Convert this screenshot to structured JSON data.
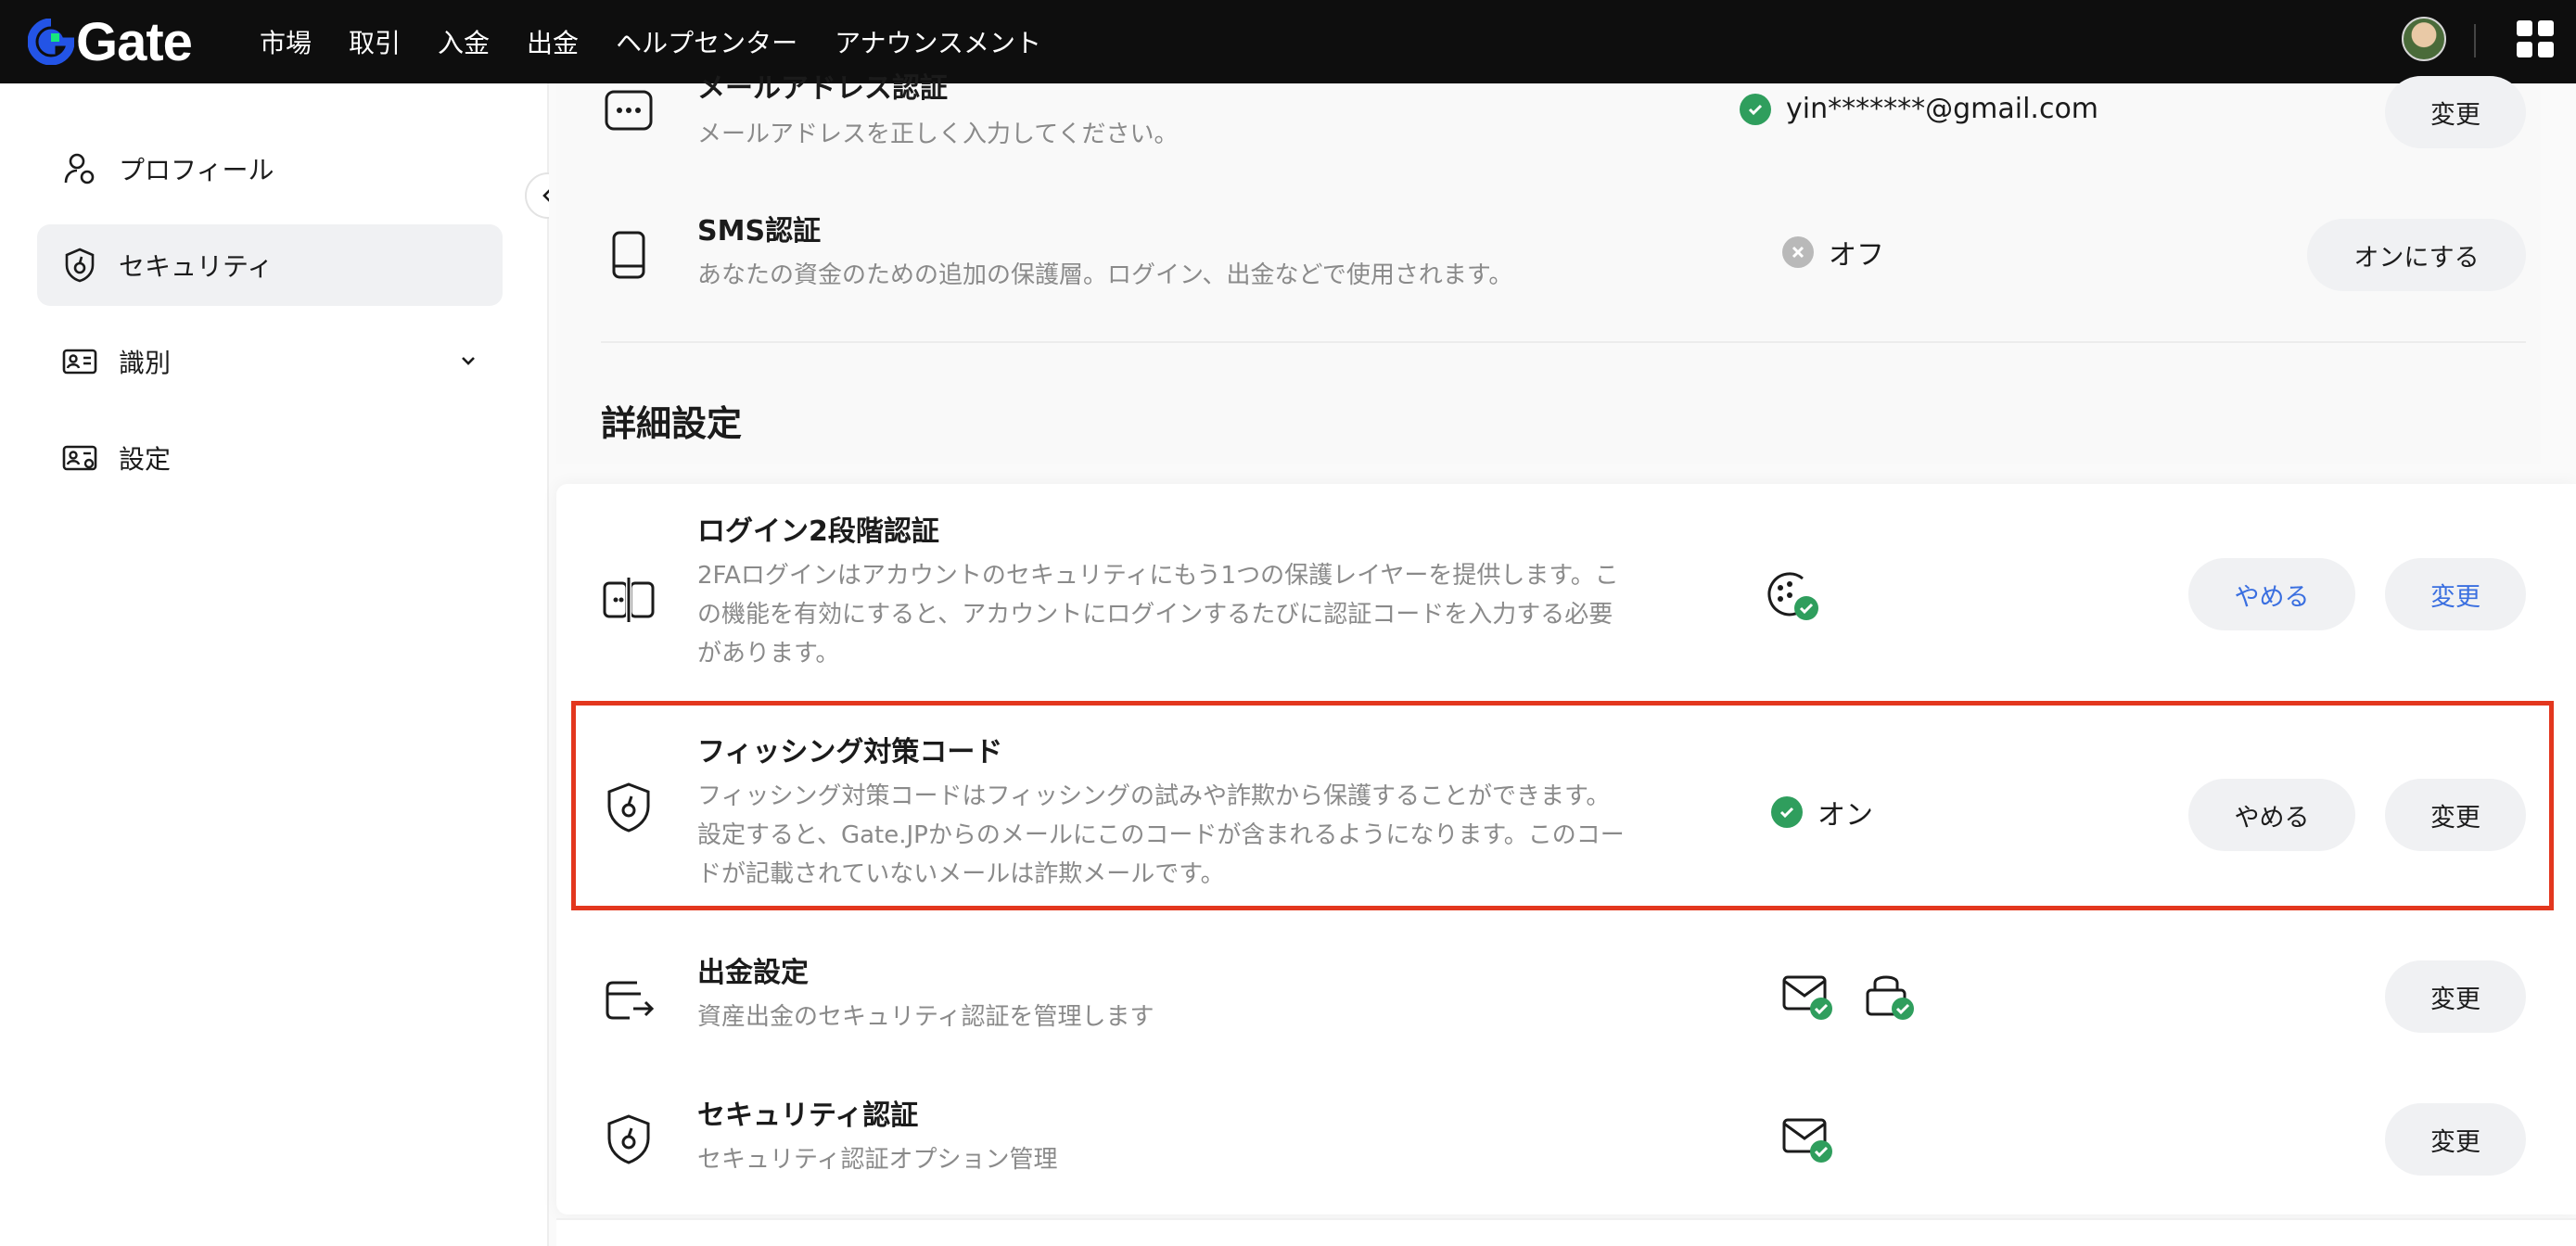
{
  "brand": {
    "name": "Gate",
    "accent": "#2354e6",
    "logo_green": "#17e77d"
  },
  "nav": {
    "items": [
      "市場",
      "取引",
      "入金",
      "出金",
      "ヘルプセンター",
      "アナウンスメント"
    ]
  },
  "sidebar": {
    "items": [
      {
        "label": "プロフィール",
        "icon": "user-icon"
      },
      {
        "label": "セキュリティ",
        "icon": "shield-icon",
        "active": true
      },
      {
        "label": "識別",
        "icon": "id-card-icon",
        "expandable": true
      },
      {
        "label": "設定",
        "icon": "settings-card-icon"
      }
    ]
  },
  "basic": {
    "email": {
      "title": "メールアドレス認証",
      "desc": "メールアドレスを正しく入力してください。",
      "status": "yin*******@gmail.com",
      "button": "変更"
    },
    "sms": {
      "title": "SMS認証",
      "desc": "あなたの資金のための追加の保護層。ログイン、出金などで使用されます。",
      "status": "オフ",
      "button": "オンにする"
    }
  },
  "advanced": {
    "section_title": "詳細設定",
    "twofa": {
      "title": "ログイン2段階認証",
      "desc": "2FAログインはアカウントのセキュリティにもう1つの保護レイヤーを提供します。この機能を有効にすると、アカウントにログインするたびに認証コードを入力する必要があります。",
      "button_stop": "やめる",
      "button_change": "変更"
    },
    "phishing": {
      "title": "フィッシング対策コード",
      "desc": "フィッシング対策コードはフィッシングの試みや詐欺から保護することができます。設定すると、Gate.JPからのメールにこのコードが含まれるようになります。このコードが記載されていないメールは詐欺メールです。",
      "status": "オン",
      "button_stop": "やめる",
      "button_change": "変更"
    },
    "withdraw": {
      "title": "出金設定",
      "desc": "資産出金のセキュリティ認証を管理します",
      "button": "変更"
    },
    "security_auth": {
      "title": "セキュリティ認証",
      "desc": "セキュリティ認証オプション管理",
      "button": "変更"
    }
  },
  "colors": {
    "check_green": "#2f9e5d",
    "highlight_red": "#e3371e",
    "link_blue": "#3a6fe0"
  }
}
